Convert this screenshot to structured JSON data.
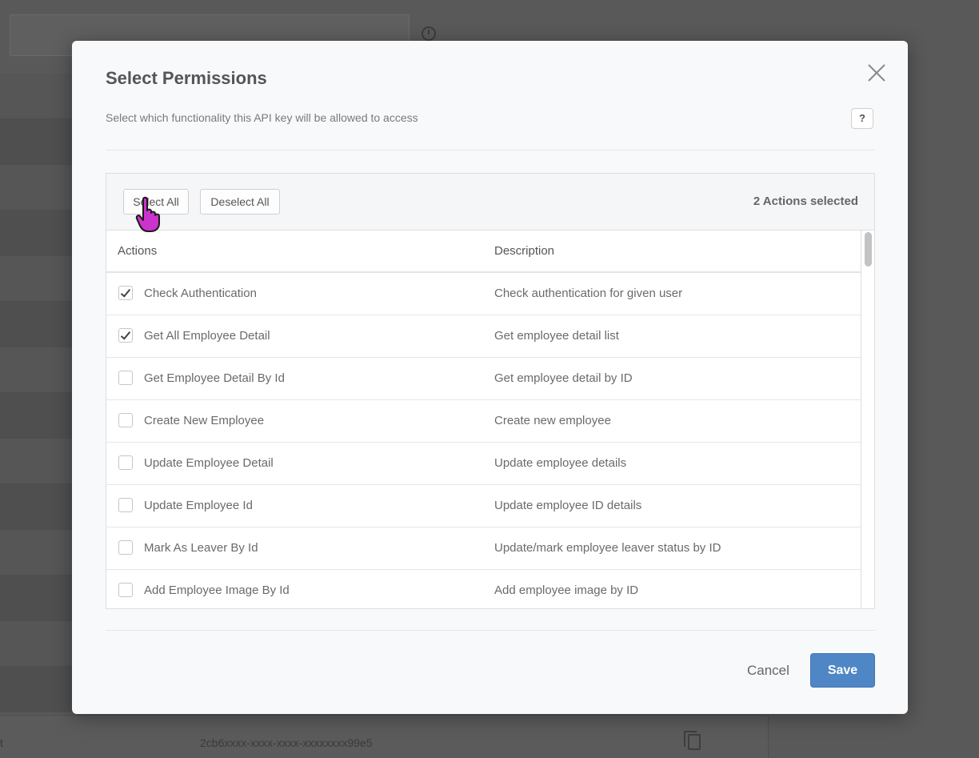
{
  "background": {
    "side_rows": 14,
    "bottom_row_label": "t",
    "api_key": "2cb6xxxx-xxxx-xxxx-xxxxxxxx99e5",
    "icons": [
      "clock-icon",
      "copy-icon"
    ]
  },
  "modal": {
    "title": "Select Permissions",
    "subtitle": "Select which functionality this API key will be allowed to access",
    "help_label": "?",
    "close_icon": "close-icon"
  },
  "toolbar": {
    "select_all_label": "Select All",
    "deselect_all_label": "Deselect All",
    "selected_count": "2 Actions selected"
  },
  "table": {
    "headers": {
      "actions": "Actions",
      "description": "Description"
    },
    "rows": [
      {
        "action": "Check Authentication",
        "description": "Check authentication for given user",
        "checked": true
      },
      {
        "action": "Get All Employee Detail",
        "description": "Get employee detail list",
        "checked": true
      },
      {
        "action": "Get Employee Detail By Id",
        "description": "Get employee detail by ID",
        "checked": false
      },
      {
        "action": "Create New Employee",
        "description": "Create new employee",
        "checked": false
      },
      {
        "action": "Update Employee Detail",
        "description": "Update employee details",
        "checked": false
      },
      {
        "action": "Update Employee Id",
        "description": "Update employee ID details",
        "checked": false
      },
      {
        "action": "Mark As Leaver By Id",
        "description": "Update/mark employee leaver status by ID",
        "checked": false
      },
      {
        "action": "Add Employee Image By Id",
        "description": "Add employee image by ID",
        "checked": false
      }
    ]
  },
  "footer": {
    "cancel_label": "Cancel",
    "save_label": "Save"
  },
  "colors": {
    "overlay": "#595959",
    "primary": "#4f86c6",
    "cursor": "#cc33cc"
  }
}
